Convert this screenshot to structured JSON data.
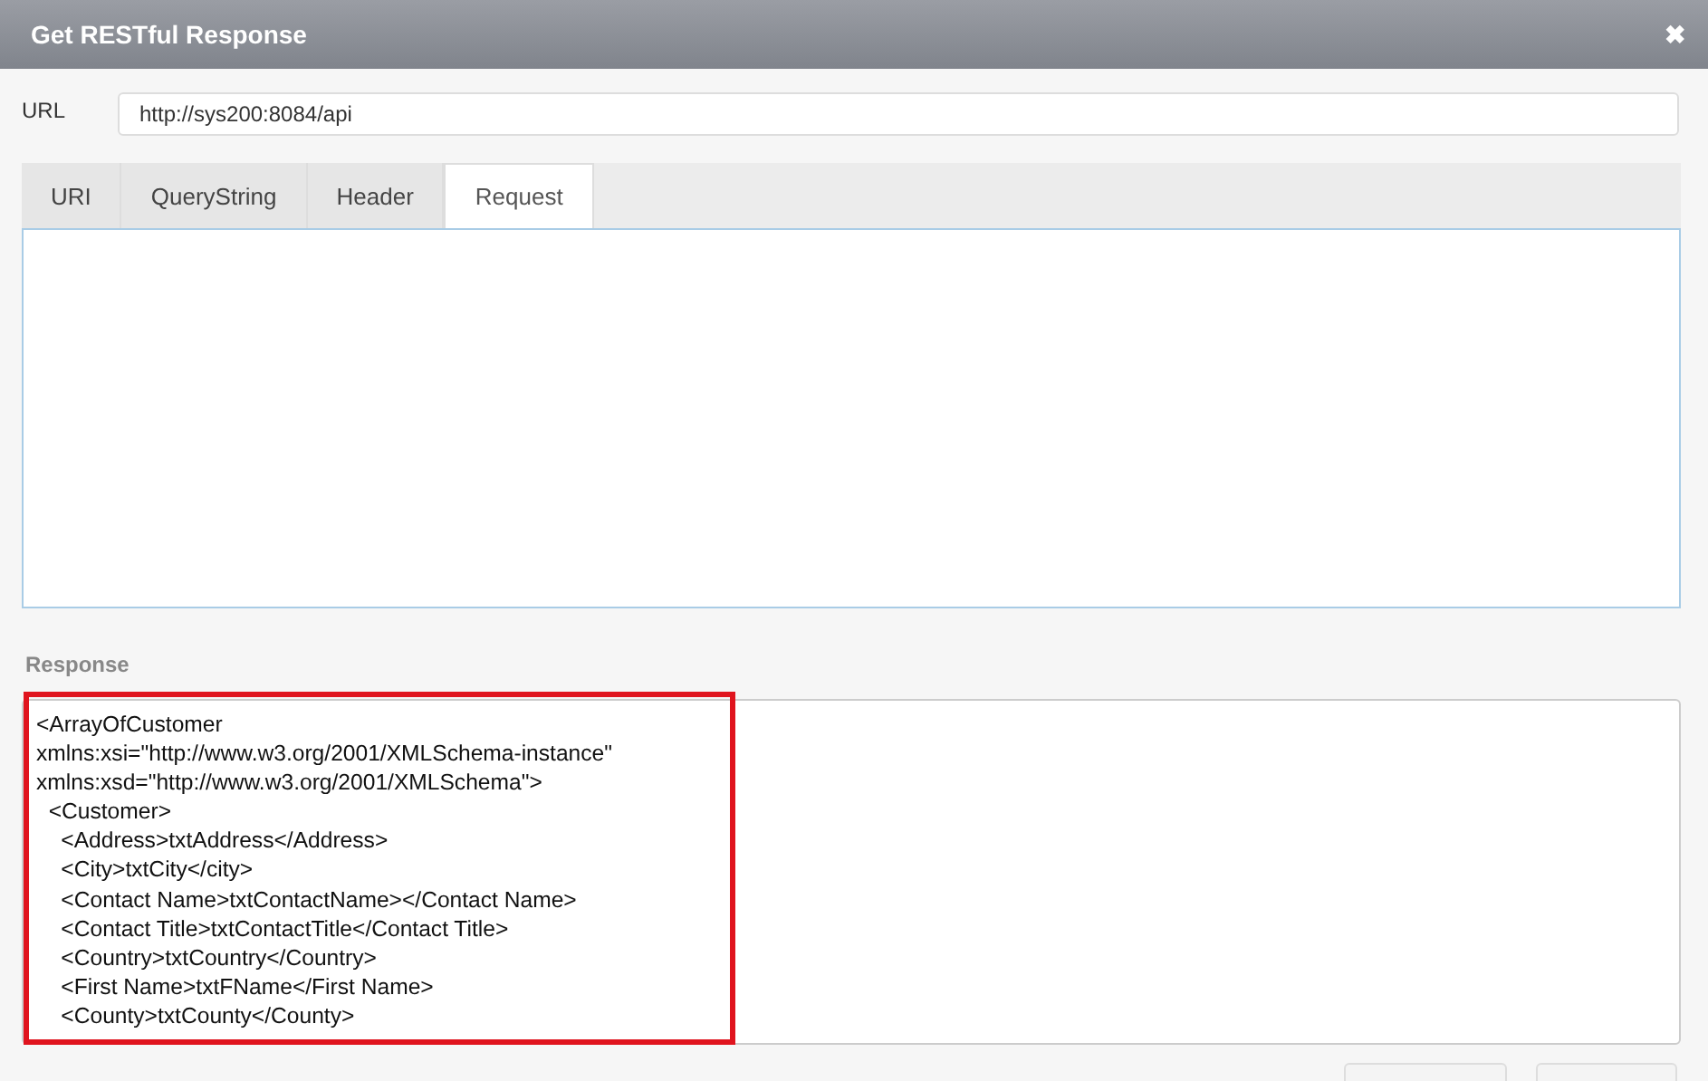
{
  "window": {
    "title": "Get RESTful Response",
    "close": "✖"
  },
  "url": {
    "label": "URL",
    "value": "http://sys200:8084/api"
  },
  "tabs": [
    {
      "label": "URI",
      "selected": false
    },
    {
      "label": "QueryString",
      "selected": false
    },
    {
      "label": "Header",
      "selected": false
    },
    {
      "label": "Request",
      "selected": true
    }
  ],
  "response": {
    "label": "Response",
    "highlighted": true,
    "lines": [
      "<ArrayOfCustomer",
      "xmlns:xsi=\"http://www.w3.org/2001/XMLSchema-instance\"",
      "xmlns:xsd=\"http://www.w3.org/2001/XMLSchema\">",
      "  <Customer>",
      "    <Address>txtAddress</Address>",
      "    <City>txtCity</city>",
      "    <Contact Name>txtContactName></Contact Name>",
      "    <Contact Title>txtContactTitle</Contact Title>",
      "    <Country>txtCountry</Country>",
      "    <First Name>txtFName</First Name>",
      "    <County>txtCounty</County>"
    ]
  },
  "footer_buttons": [
    {
      "kind": "button"
    },
    {
      "kind": "button"
    }
  ]
}
